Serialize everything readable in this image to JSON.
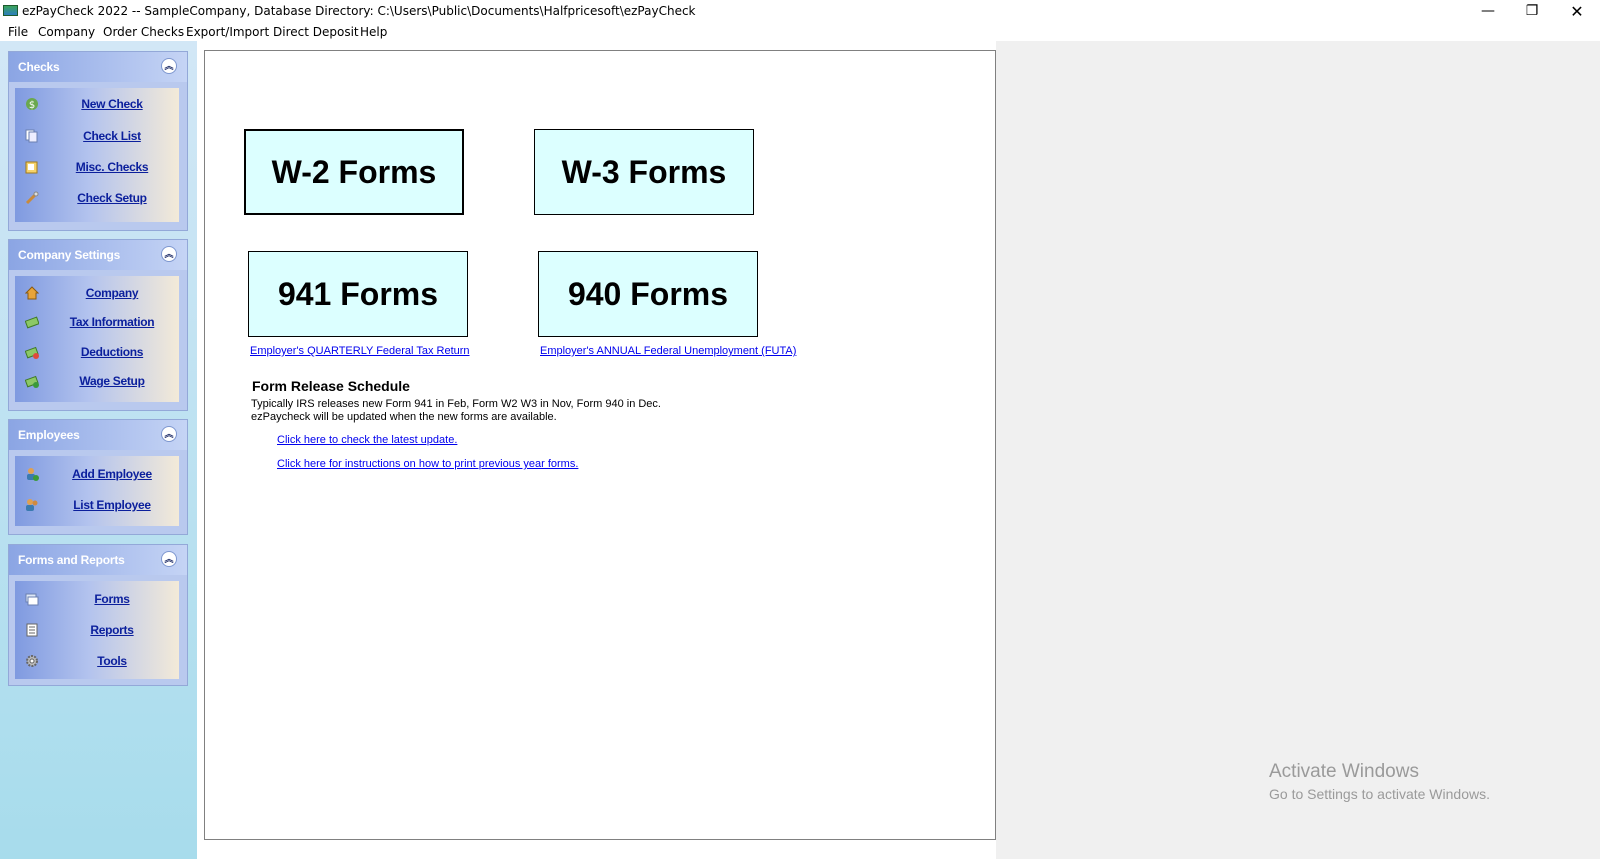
{
  "window": {
    "title": "ezPayCheck 2022 -- SampleCompany, Database Directory: C:\\Users\\Public\\Documents\\Halfpricesoft\\ezPayCheck",
    "minimize": "—",
    "maximize": "❐",
    "close": "✕"
  },
  "menu": [
    "File",
    "Company",
    "Order Checks",
    "Export/Import",
    "Direct Deposit",
    "Help"
  ],
  "sidebar": {
    "collapse_glyph": "︽",
    "groups": [
      {
        "title": "Checks",
        "items": [
          {
            "label": "New Check",
            "icon": "dollar-icon"
          },
          {
            "label": "Check List",
            "icon": "pages-icon"
          },
          {
            "label": "Misc. Checks",
            "icon": "misc-icon"
          },
          {
            "label": "Check Setup",
            "icon": "wrench-icon"
          }
        ]
      },
      {
        "title": "Company Settings",
        "items": [
          {
            "label": "Company",
            "icon": "house-icon"
          },
          {
            "label": "Tax Information",
            "icon": "money-icon"
          },
          {
            "label": "Deductions",
            "icon": "money-minus-icon"
          },
          {
            "label": "Wage Setup",
            "icon": "money-plus-icon"
          }
        ]
      },
      {
        "title": "Employees",
        "items": [
          {
            "label": "Add Employee",
            "icon": "add-user-icon"
          },
          {
            "label": "List Employee",
            "icon": "users-icon"
          }
        ]
      },
      {
        "title": "Forms and Reports",
        "items": [
          {
            "label": "Forms",
            "icon": "forms-icon"
          },
          {
            "label": "Reports",
            "icon": "report-icon"
          },
          {
            "label": "Tools",
            "icon": "gear-icon"
          }
        ]
      }
    ]
  },
  "main": {
    "buttons": {
      "w2": "W-2 Forms",
      "w3": "W-3 Forms",
      "f941": "941 Forms",
      "f940": "940 Forms"
    },
    "links": {
      "quarterly": "Employer's QUARTERLY Federal Tax Return",
      "annual": "Employer's ANNUAL Federal Unemployment (FUTA)",
      "update": "Click here to check the latest update.",
      "instructions": "Click here for instructions on how to print previous year forms."
    },
    "schedule": {
      "title": "Form Release Schedule",
      "line1": "Typically IRS releases new Form 941 in Feb, Form W2  W3 in Nov, Form 940 in Dec.",
      "line2": "ezPaycheck will be updated when the new forms are available."
    }
  },
  "watermark": {
    "title": "Activate Windows",
    "subtitle": "Go to Settings to activate Windows."
  }
}
